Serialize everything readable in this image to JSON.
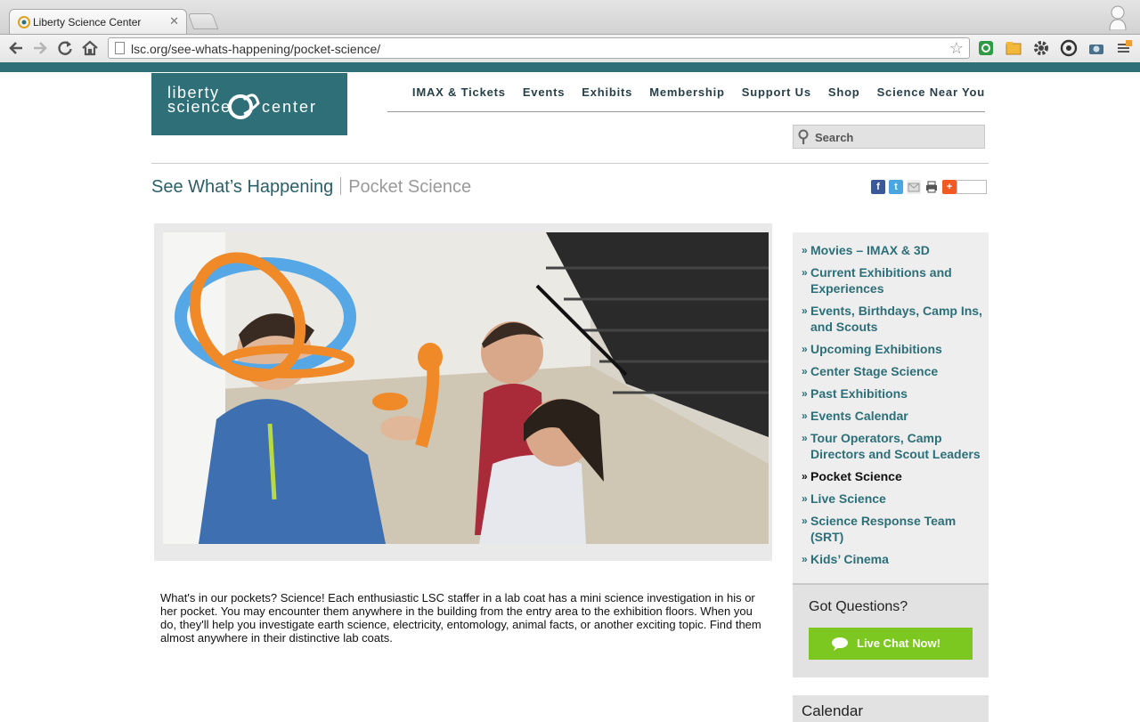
{
  "browser": {
    "tab_title": "Liberty Science Center",
    "tab_close": "✕",
    "url": "lsc.org/see-whats-happening/pocket-science/"
  },
  "logo": {
    "line1": "liberty",
    "line2": "science",
    "line3": "center"
  },
  "main_nav": [
    "IMAX & Tickets",
    "Events",
    "Exhibits",
    "Membership",
    "Support Us",
    "Shop",
    "Science Near You"
  ],
  "search": {
    "placeholder": "Search"
  },
  "breadcrumb": {
    "section": "See What’s Happening",
    "page": "Pocket Science"
  },
  "share_icons": [
    "facebook-icon",
    "twitter-icon",
    "email-icon",
    "print-icon",
    "addthis-icon"
  ],
  "body_text": "What's in our pockets? Science! Each enthusiastic LSC staffer in a lab coat has a mini science investigation in his or her pocket. You may encounter them anywhere in the building from the entry area to the exhibition floors. When you do, they'll help you investigate earth science, electricity, entomology, animal facts, or another exciting topic. Find them almost anywhere in their distinctive lab coats.",
  "sidebar": {
    "bullet": "»",
    "items": [
      {
        "label": "Movies – IMAX & 3D"
      },
      {
        "label": "Current Exhibitions and Experiences"
      },
      {
        "label": "Events, Birthdays, Camp Ins, and Scouts"
      },
      {
        "label": "Upcoming Exhibitions"
      },
      {
        "label": "Center Stage Science"
      },
      {
        "label": "Past Exhibitions"
      },
      {
        "label": "Events Calendar"
      },
      {
        "label": "Tour Operators, Camp Directors and Scout Leaders"
      },
      {
        "label": "Pocket Science",
        "active": true
      },
      {
        "label": "Live Science"
      },
      {
        "label": "Science Response Team (SRT)"
      },
      {
        "label": "Kids’ Cinema"
      }
    ],
    "questions_title": "Got Questions?",
    "chat_label": "Live Chat Now!",
    "calendar_title": "Calendar"
  },
  "colors": {
    "brand_teal": "#2f6f78",
    "link_teal": "#2c6f78",
    "chat_green": "#7dc820"
  }
}
